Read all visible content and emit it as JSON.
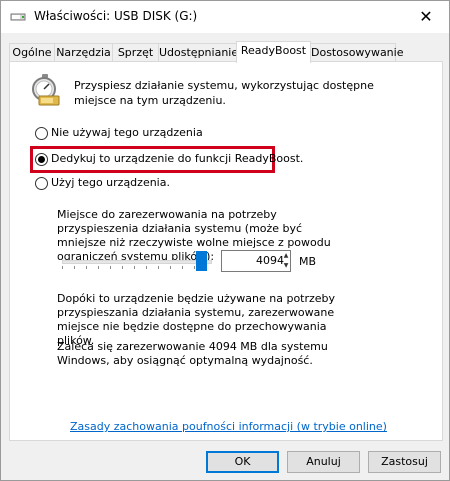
{
  "window": {
    "title": "Właściwości: USB DISK (G:)",
    "close_glyph": "✕"
  },
  "tabs": [
    {
      "label": "Ogólne",
      "active": false
    },
    {
      "label": "Narzędzia",
      "active": false
    },
    {
      "label": "Sprzęt",
      "active": false
    },
    {
      "label": "Udostępnianie",
      "active": false
    },
    {
      "label": "ReadyBoost",
      "active": true
    },
    {
      "label": "Dostosowywanie",
      "active": false
    }
  ],
  "readyboost": {
    "intro": "Przyspiesz działanie systemu, wykorzystując dostępne miejsce na tym urządzeniu.",
    "options": [
      {
        "label": "Nie używaj tego urządzenia",
        "checked": false
      },
      {
        "label": "Dedykuj to urządzenie do funkcji ReadyBoost.",
        "checked": true
      },
      {
        "label": "Użyj tego urządzenia.",
        "checked": false
      }
    ],
    "highlight_color": "#d0021b",
    "reserve_text": "Miejsce do zarezerwowania na potrzeby przyspieszenia działania systemu (może być mniejsze niż rzeczywiste wolne miejsce z powodu ograniczeń systemu plików):",
    "slider_level_fraction": 1.0,
    "reserve_value": "4094",
    "reserve_unit": "MB",
    "dedicate_text": "Dopóki to urządzenie będzie używane na potrzeby przyspieszania działania systemu, zarezerwowane miejsce nie będzie dostępne do przechowywania plików.",
    "recommend_text": "Zaleca się zarezerwowanie 4094 MB dla systemu Windows, aby osiągnąć optymalną wydajność.",
    "privacy_link": "Zasady zachowania poufności informacji (w trybie online)"
  },
  "buttons": {
    "ok": "OK",
    "cancel": "Anuluj",
    "apply": "Zastosuj"
  },
  "colors": {
    "accent": "#0078d7",
    "link": "#0066cc"
  },
  "icons": {
    "title": "usb-drive-icon",
    "readyboost": "readyboost-stopwatch-icon"
  }
}
